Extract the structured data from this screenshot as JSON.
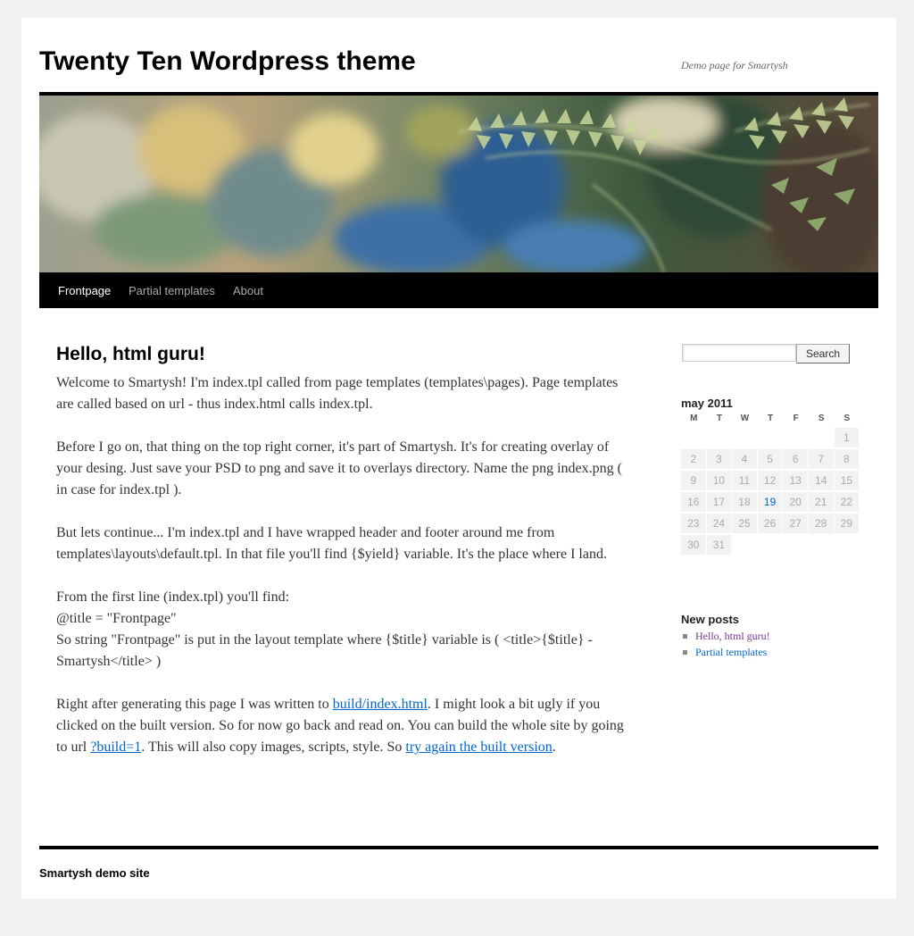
{
  "header": {
    "site_title": "Twenty Ten Wordpress theme",
    "site_description": "Demo page for Smartysh"
  },
  "nav": {
    "items": [
      {
        "label": "Frontpage",
        "current": true
      },
      {
        "label": "Partial templates",
        "current": false
      },
      {
        "label": "About",
        "current": false
      }
    ]
  },
  "content": {
    "title": "Hello, html guru!",
    "p1": "Welcome to Smartysh! I'm index.tpl called from page templates (templates\\pages). Page templates are called based on url - thus index.html calls index.tpl.",
    "p2": "Before I go on, that thing on the top right corner, it's part of Smartysh. It's for creating overlay of your desing. Just save your PSD to png and save it to overlays directory. Name the png index.png ( in case for index.tpl ).",
    "p3": "But lets continue... I'm index.tpl and I have wrapped header and footer around me from templates\\layouts\\default.tpl. In that file you'll find {$yield} variable. It's the place where I land.",
    "p4_line1": "From the first line (index.tpl) you'll find:",
    "p4_line2": "@title = \"Frontpage\"",
    "p4_line3": "So string \"Frontpage\" is put in the layout template where {$title} variable is ( <title>{$title} - Smartysh</title> )",
    "p5_text1": "Right after generating this page I was written to ",
    "p5_link1": "build/index.html",
    "p5_text2": ". I might look a bit ugly if you clicked on the built version. So for now go back and read on. You can build the whole site by going to url ",
    "p5_link2": "?build=1",
    "p5_text3": ". This will also copy images, scripts, style. So ",
    "p5_link3": "try again the built version",
    "p5_text4": "."
  },
  "sidebar": {
    "search_button": "Search",
    "search_value": "",
    "calendar": {
      "caption": "may 2011",
      "weekdays": [
        "M",
        "T",
        "W",
        "T",
        "F",
        "S",
        "S"
      ],
      "rows": [
        [
          "",
          "",
          "",
          "",
          "",
          "",
          "1"
        ],
        [
          "2",
          "3",
          "4",
          "5",
          "6",
          "7",
          "8"
        ],
        [
          "9",
          "10",
          "11",
          "12",
          "13",
          "14",
          "15"
        ],
        [
          "16",
          "17",
          "18",
          "19",
          "20",
          "21",
          "22"
        ],
        [
          "23",
          "24",
          "25",
          "26",
          "27",
          "28",
          "29"
        ],
        [
          "30",
          "31",
          "",
          "",
          "",
          "",
          ""
        ]
      ],
      "linked_days": [
        "19"
      ]
    },
    "new_posts_title": "New posts",
    "new_posts": [
      "Hello, html guru!",
      "Partial templates"
    ]
  },
  "footer": {
    "text": "Smartysh demo site"
  },
  "colors": {
    "link": "#0066cc",
    "visited": "#743399",
    "nav_bg": "#000000",
    "page_bg": "#f1f1f1"
  }
}
